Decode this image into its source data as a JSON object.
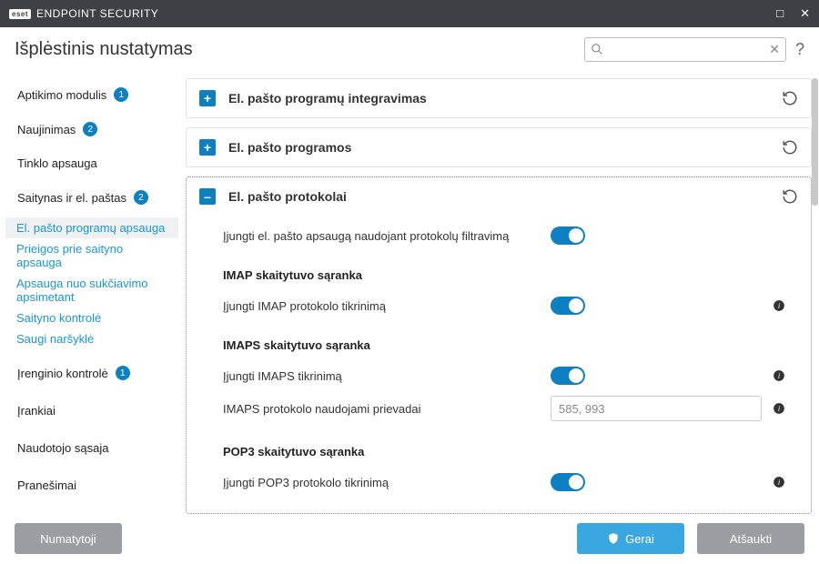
{
  "titlebar": {
    "brand": "eset",
    "product": "ENDPOINT SECURITY"
  },
  "page_title": "Išplėstinis nustatymas",
  "search": {
    "placeholder": ""
  },
  "sidebar": {
    "items": [
      {
        "label": "Aptikimo modulis",
        "badge": "1"
      },
      {
        "label": "Naujinimas",
        "badge": "2"
      },
      {
        "label": "Tinklo apsauga"
      },
      {
        "label": "Saitynas ir el. paštas",
        "badge": "2",
        "subs": [
          {
            "label": "El. pašto programų apsauga",
            "active": true
          },
          {
            "label": "Prieigos prie saityno apsauga"
          },
          {
            "label": "Apsauga nuo sukčiavimo apsimetant"
          },
          {
            "label": "Saityno kontrolė"
          },
          {
            "label": "Saugi naršyklė"
          }
        ]
      },
      {
        "label": "Įrenginio kontrolė",
        "badge": "1"
      },
      {
        "label": "Įrankiai"
      },
      {
        "label": "Naudotojo sąsaja"
      },
      {
        "label": "Pranešimai"
      }
    ]
  },
  "panels": [
    {
      "title": "El. pašto programų integravimas"
    },
    {
      "title": "El. pašto programos"
    },
    {
      "title": "El. pašto protokolai"
    }
  ],
  "settings": {
    "enable_filter": "Įjungti el. pašto apsaugą naudojant protokolų filtravimą",
    "imap_h": "IMAP skaitytuvo sąranka",
    "imap_enable": "Įjungti IMAP protokolo tikrinimą",
    "imaps_h": "IMAPS skaitytuvo sąranka",
    "imaps_enable": "Įjungti IMAPS tikrinimą",
    "imaps_ports_label": "IMAPS protokolo naudojami prievadai",
    "imaps_ports_value": "585, 993",
    "pop3_h": "POP3 skaitytuvo sąranka",
    "pop3_enable": "Įjungti POP3 protokolo tikrinimą"
  },
  "footer": {
    "default": "Numatytoji",
    "ok": "Gerai",
    "cancel": "Atšaukti"
  }
}
